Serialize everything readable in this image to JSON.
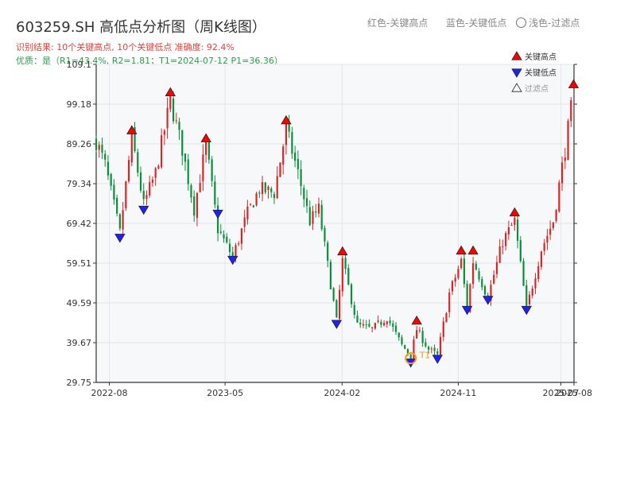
{
  "header": {
    "title": "603259.SH 高低点分析图（周K线图）",
    "legend_red": "红色-关键高点",
    "legend_blue": "蓝色-关键低点",
    "legend_light": "浅色-过滤点",
    "result_line": "识别结果: 10个关键高点, 10个关键低点   准确度: 92.4%",
    "quality_line": "优质：是（R1=43.4%, R2=1.81；T1=2024-07-12 P1=36.36）"
  },
  "colors": {
    "up": "#d62728",
    "down": "#0a8f3a",
    "high_marker": "#ff0000",
    "low_marker": "#1f1fff",
    "plot_bg": "#f7f8fa",
    "t1_circle": "#f59a16"
  },
  "chart_data": {
    "type": "candlestick",
    "title": "603259.SH 高低点分析图（周K线图）",
    "ylim": [
      29.75,
      109.1
    ],
    "yticks": [
      29.75,
      39.67,
      49.59,
      59.51,
      69.42,
      79.34,
      89.26,
      99.18,
      109.1
    ],
    "ytick_labels": [
      "29.75",
      "39.67",
      "49.59",
      "59.51",
      "69.42",
      "79.34",
      "89.26",
      "99.18",
      "109.1"
    ],
    "xlim": [
      "2022-07-01",
      "2025-08-01"
    ],
    "xticks": [
      "2022-08-01",
      "2023-05-01",
      "2024-02-01",
      "2024-11-01",
      "2025-07-01",
      "2025-08-01"
    ],
    "xtick_labels": [
      "2022-08",
      "2023-05",
      "2024-02",
      "2024-11",
      "2025-07",
      "2025-08"
    ],
    "price_path": [
      [
        "2022-07-01",
        90
      ],
      [
        "2022-07-22",
        84
      ],
      [
        "2022-08-26",
        67
      ],
      [
        "2022-09-23",
        91
      ],
      [
        "2022-10-21",
        74
      ],
      [
        "2022-11-18",
        82
      ],
      [
        "2022-12-23",
        100
      ],
      [
        "2023-01-20",
        88
      ],
      [
        "2023-02-17",
        73
      ],
      [
        "2023-03-17",
        89
      ],
      [
        "2023-04-14",
        68
      ],
      [
        "2023-05-19",
        61
      ],
      [
        "2023-06-23",
        72
      ],
      [
        "2023-07-21",
        78
      ],
      [
        "2023-08-25",
        77
      ],
      [
        "2023-09-22",
        93
      ],
      [
        "2023-10-20",
        82
      ],
      [
        "2023-11-17",
        70
      ],
      [
        "2023-12-08",
        73
      ],
      [
        "2024-01-19",
        45
      ],
      [
        "2024-02-02",
        60
      ],
      [
        "2024-03-08",
        44
      ],
      [
        "2024-04-12",
        43
      ],
      [
        "2024-05-17",
        46
      ],
      [
        "2024-06-21",
        39
      ],
      [
        "2024-07-12",
        36.4
      ],
      [
        "2024-07-26",
        43
      ],
      [
        "2024-08-23",
        38
      ],
      [
        "2024-09-13",
        36.5
      ],
      [
        "2024-10-11",
        52
      ],
      [
        "2024-11-08",
        60
      ],
      [
        "2024-11-22",
        48
      ],
      [
        "2024-12-06",
        60
      ],
      [
        "2025-01-10",
        51
      ],
      [
        "2025-02-14",
        65
      ],
      [
        "2025-03-14",
        70
      ],
      [
        "2025-04-11",
        48
      ],
      [
        "2025-05-16",
        63
      ],
      [
        "2025-06-13",
        70
      ],
      [
        "2025-07-11",
        88
      ],
      [
        "2025-07-31",
        102
      ]
    ],
    "key_highs": [
      {
        "date": "2022-09-23",
        "value": 91.0
      },
      {
        "date": "2022-12-23",
        "value": 100.5
      },
      {
        "date": "2023-03-17",
        "value": 89.0
      },
      {
        "date": "2023-09-22",
        "value": 93.5
      },
      {
        "date": "2024-02-02",
        "value": 60.8
      },
      {
        "date": "2024-07-26",
        "value": 43.5
      },
      {
        "date": "2024-11-08",
        "value": 61.0
      },
      {
        "date": "2024-12-06",
        "value": 61.0
      },
      {
        "date": "2025-03-14",
        "value": 70.5
      },
      {
        "date": "2025-07-31",
        "value": 102.5
      }
    ],
    "key_lows": [
      {
        "date": "2022-08-26",
        "value": 67.5
      },
      {
        "date": "2022-10-21",
        "value": 74.5
      },
      {
        "date": "2023-04-14",
        "value": 73.5
      },
      {
        "date": "2023-05-19",
        "value": 62.0
      },
      {
        "date": "2024-01-19",
        "value": 46.0
      },
      {
        "date": "2024-07-12",
        "value": 36.36
      },
      {
        "date": "2024-09-13",
        "value": 37.3
      },
      {
        "date": "2024-11-22",
        "value": 49.5
      },
      {
        "date": "2025-01-10",
        "value": 52.0
      },
      {
        "date": "2025-04-11",
        "value": 49.5
      }
    ],
    "t1": {
      "label": "T1",
      "date": "2024-07-12",
      "value": 36.36
    },
    "legend": [
      "关键高点",
      "关键低点",
      "过滤点"
    ],
    "legend_position": "top-right",
    "grid": true
  }
}
